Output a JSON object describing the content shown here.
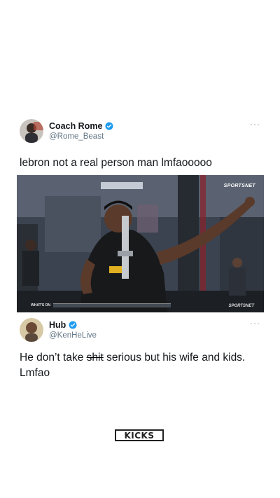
{
  "tweet1": {
    "display_name": "Coach Rome",
    "handle": "@Rome_Beast",
    "text": "lebron not a real person man lmfaooooo",
    "more_label": "···"
  },
  "video": {
    "broadcast_logo": "SPORTSNET",
    "bottom_logo": "SPORTSNET",
    "ticker_label": "WHAT'S ON"
  },
  "tweet2": {
    "display_name": "Hub",
    "handle": "@KenHeLive",
    "text_before": "He don’t take ",
    "text_struck": "shit",
    "text_after": " serious but his wife and kids. Lmfao",
    "more_label": "···"
  },
  "brand": {
    "logo_text": "KICKS"
  },
  "colors": {
    "verified_blue": "#1d9bf0",
    "handle_gray": "#657786"
  },
  "icons": {
    "verified": "verified-badge-icon",
    "more": "more-icon"
  }
}
